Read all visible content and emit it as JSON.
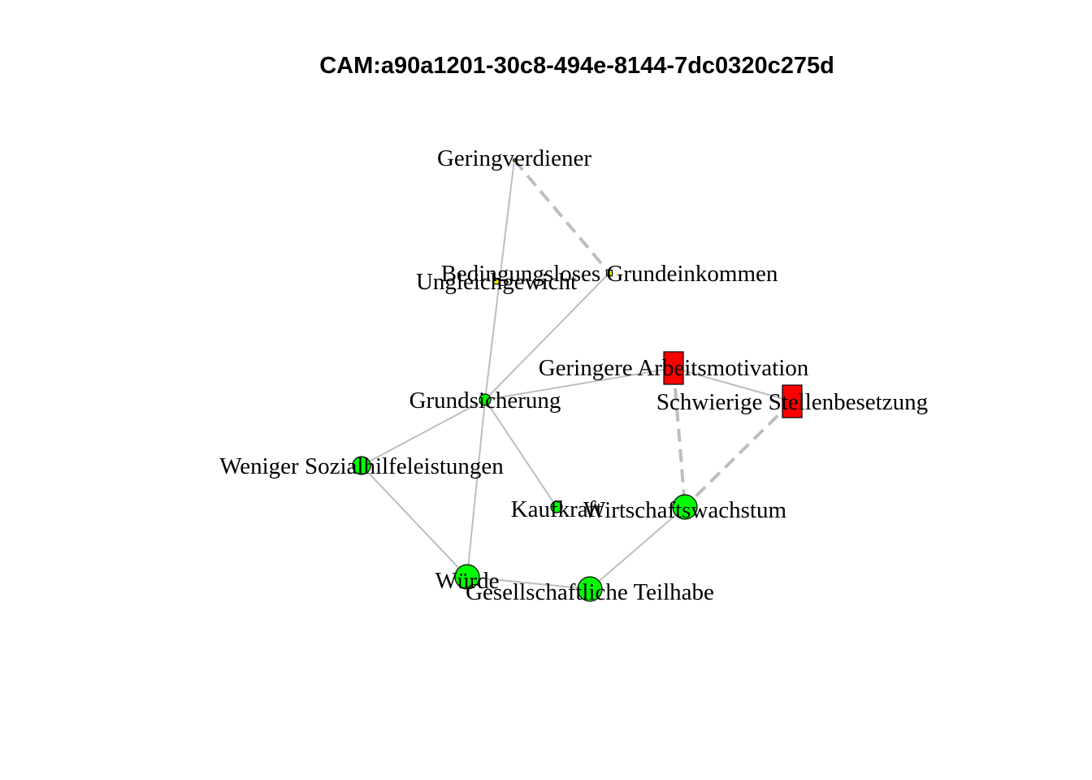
{
  "title": "CAM:a90a1201-30c8-494e-8144-7dc0320c275d",
  "colors": {
    "positive": "#00ff00",
    "negative": "#ff0000",
    "neutral": "#ffff00",
    "edge": "#bebebe"
  },
  "nodes": [
    {
      "id": "geringverdiener",
      "label": "Geringverdiener",
      "valence": "neutral",
      "shape": "point"
    },
    {
      "id": "bge",
      "label": "Bedingungsloses Grundeinkommen",
      "valence": "neutral",
      "shape": "square"
    },
    {
      "id": "ungleichgewicht",
      "label": "Ungleichgewicht",
      "valence": "neutral",
      "shape": "square"
    },
    {
      "id": "arbeitsmotivation",
      "label": "Geringere Arbeitsmotivation",
      "valence": "negative",
      "shape": "rect"
    },
    {
      "id": "stellenbesetzung",
      "label": "Schwierige Stellenbesetzung",
      "valence": "negative",
      "shape": "rect"
    },
    {
      "id": "grundsicherung",
      "label": "Grundsicherung",
      "valence": "positive",
      "shape": "circle"
    },
    {
      "id": "sozialhilfe",
      "label": "Weniger Sozialhilfeleistungen",
      "valence": "positive",
      "shape": "circle"
    },
    {
      "id": "kaufkraft",
      "label": "Kaufkraft",
      "valence": "positive",
      "shape": "circle"
    },
    {
      "id": "wirtschaftswachstum",
      "label": "Wirtschaftswachstum",
      "valence": "positive",
      "shape": "circle"
    },
    {
      "id": "wuerde",
      "label": "Würde",
      "valence": "positive",
      "shape": "circle"
    },
    {
      "id": "teilhabe",
      "label": "Gesellschaftliche Teilhabe",
      "valence": "positive",
      "shape": "circle"
    }
  ],
  "edges": [
    {
      "from": "geringverdiener",
      "to": "bge",
      "style": "dashed"
    },
    {
      "from": "geringverdiener",
      "to": "grundsicherung",
      "style": "solid"
    },
    {
      "from": "bge",
      "to": "grundsicherung",
      "style": "solid"
    },
    {
      "from": "grundsicherung",
      "to": "arbeitsmotivation",
      "style": "solid"
    },
    {
      "from": "grundsicherung",
      "to": "sozialhilfe",
      "style": "solid"
    },
    {
      "from": "grundsicherung",
      "to": "kaufkraft",
      "style": "solid"
    },
    {
      "from": "grundsicherung",
      "to": "wuerde",
      "style": "solid"
    },
    {
      "from": "arbeitsmotivation",
      "to": "stellenbesetzung",
      "style": "solid"
    },
    {
      "from": "arbeitsmotivation",
      "to": "wirtschaftswachstum",
      "style": "dashed"
    },
    {
      "from": "stellenbesetzung",
      "to": "wirtschaftswachstum",
      "style": "dashed"
    },
    {
      "from": "sozialhilfe",
      "to": "wuerde",
      "style": "solid"
    },
    {
      "from": "wuerde",
      "to": "teilhabe",
      "style": "solid"
    },
    {
      "from": "teilhabe",
      "to": "wirtschaftswachstum",
      "style": "solid"
    }
  ]
}
